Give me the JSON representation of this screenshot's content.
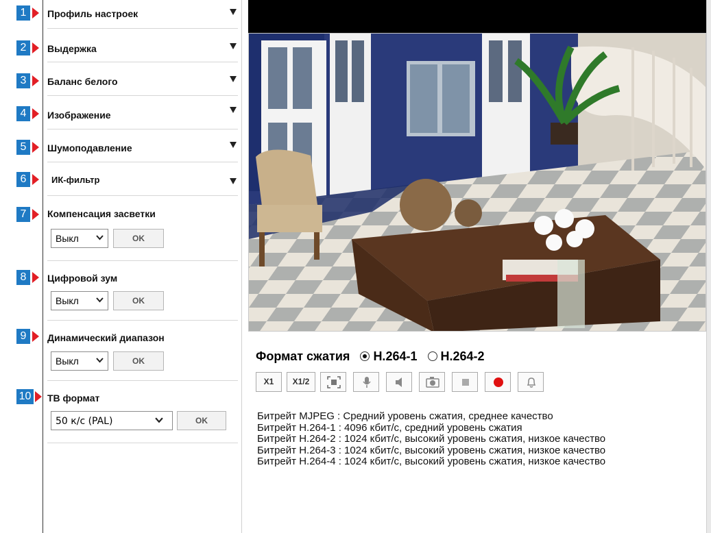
{
  "markers": [
    "1",
    "2",
    "3",
    "4",
    "5",
    "6",
    "7",
    "8",
    "9",
    "10"
  ],
  "settings": {
    "profile": "Профиль настроек",
    "shutter": "Выдержка",
    "white_balance": "Баланс белого",
    "image": "Изображение",
    "noise_reduction": "Шумоподавление",
    "ir_filter": "ИК-фильтр",
    "blc": {
      "label": "Компенсация засветки",
      "value": "Выкл",
      "ok": "OK"
    },
    "digital_zoom": {
      "label": "Цифровой зум",
      "value": "Выкл",
      "ok": "OK"
    },
    "dynamic_range": {
      "label": "Динамический диапазон",
      "value": "Выкл",
      "ok": "OK"
    },
    "tv_format": {
      "label": "ТВ формат",
      "value": "50 к/с (PAL)",
      "ok": "OK"
    }
  },
  "compression": {
    "label": "Формат сжатия",
    "options": [
      "H.264-1",
      "H.264-2"
    ],
    "selected": "H.264-1"
  },
  "controls": {
    "x1": "X1",
    "x12": "X1/2",
    "icons": [
      "fullscreen-icon",
      "microphone-icon",
      "speaker-icon",
      "camera-icon",
      "stop-icon",
      "record-icon",
      "alarm-bell-icon"
    ]
  },
  "bitrates": [
    "Битрейт MJPEG : Средний уровень сжатия, среднее качество",
    "Битрейт H.264-1 : 4096 кбит/с, средний уровень сжатия",
    "Битрейт H.264-2 : 1024 кбит/с, высокий уровень сжатия, низкое качество",
    "Битрейт H.264-3 : 1024 кбит/с, высокий уровень сжатия, низкое качество",
    "Битрейт H.264-4 : 1024 кбит/с, высокий уровень сжатия, низкое качество"
  ],
  "colors": {
    "marker_bg": "#1f7ac4",
    "marker_arrow": "#e21f26",
    "record": "#e01010"
  }
}
